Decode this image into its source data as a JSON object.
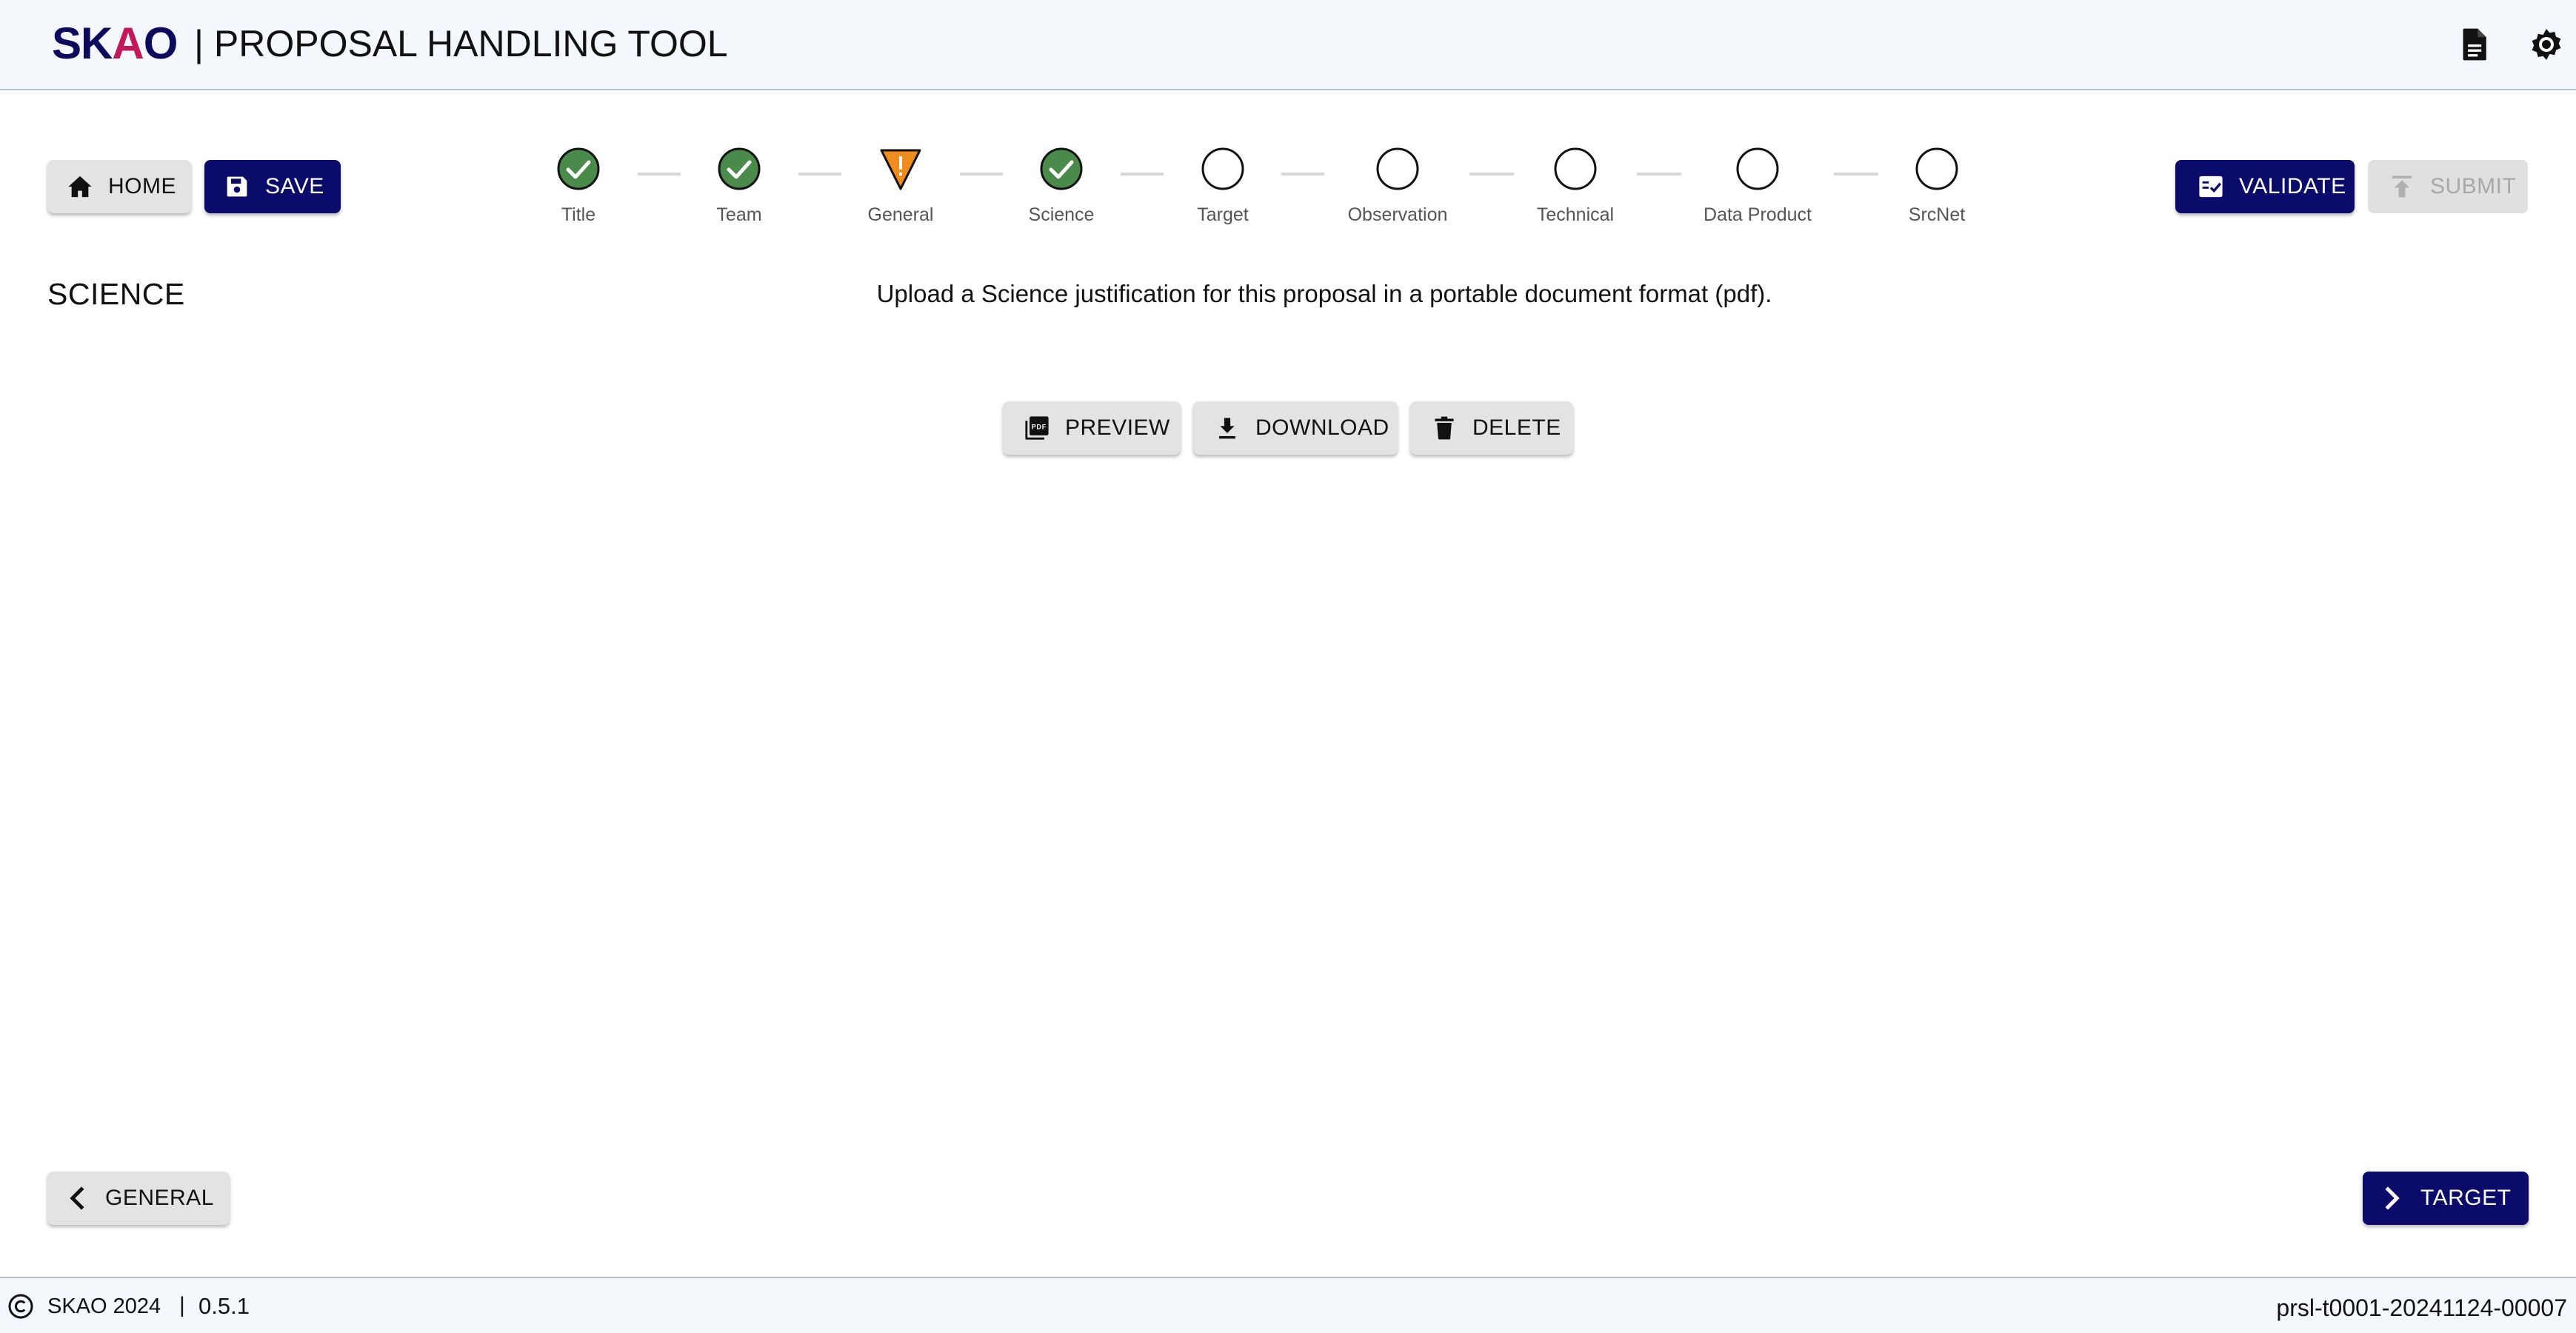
{
  "header": {
    "logo_prefix": "SK",
    "logo_accent": "A",
    "logo_suffix": "O",
    "title": "| PROPOSAL HANDLING TOOL",
    "icons": [
      "document-icon",
      "settings-icon"
    ]
  },
  "toolbar": {
    "home_label": "HOME",
    "save_label": "SAVE",
    "validate_label": "VALIDATE",
    "submit_label": "SUBMIT"
  },
  "stepper": {
    "steps": [
      {
        "label": "Title",
        "status": "complete"
      },
      {
        "label": "Team",
        "status": "complete"
      },
      {
        "label": "General",
        "status": "warning"
      },
      {
        "label": "Science",
        "status": "complete"
      },
      {
        "label": "Target",
        "status": "empty"
      },
      {
        "label": "Observation",
        "status": "empty"
      },
      {
        "label": "Technical",
        "status": "empty"
      },
      {
        "label": "Data Product",
        "status": "empty"
      },
      {
        "label": "SrcNet",
        "status": "empty"
      }
    ]
  },
  "page": {
    "section_title": "SCIENCE",
    "instruction": "Upload a Science justification for this proposal in a portable document format (pdf)."
  },
  "file_actions": {
    "preview_label": "PREVIEW",
    "download_label": "DOWNLOAD",
    "delete_label": "DELETE"
  },
  "nav": {
    "prev_label": "GENERAL",
    "next_label": "TARGET"
  },
  "footer": {
    "copyright": "SKAO 2024",
    "separator": "|",
    "version": "0.5.1",
    "proposal_id": "prsl-t0001-20241124-00007"
  },
  "colors": {
    "primary": "#0b0b6b",
    "complete": "#4a8a4a",
    "warning": "#f08c1e",
    "header_bg": "#f4f7fb"
  }
}
